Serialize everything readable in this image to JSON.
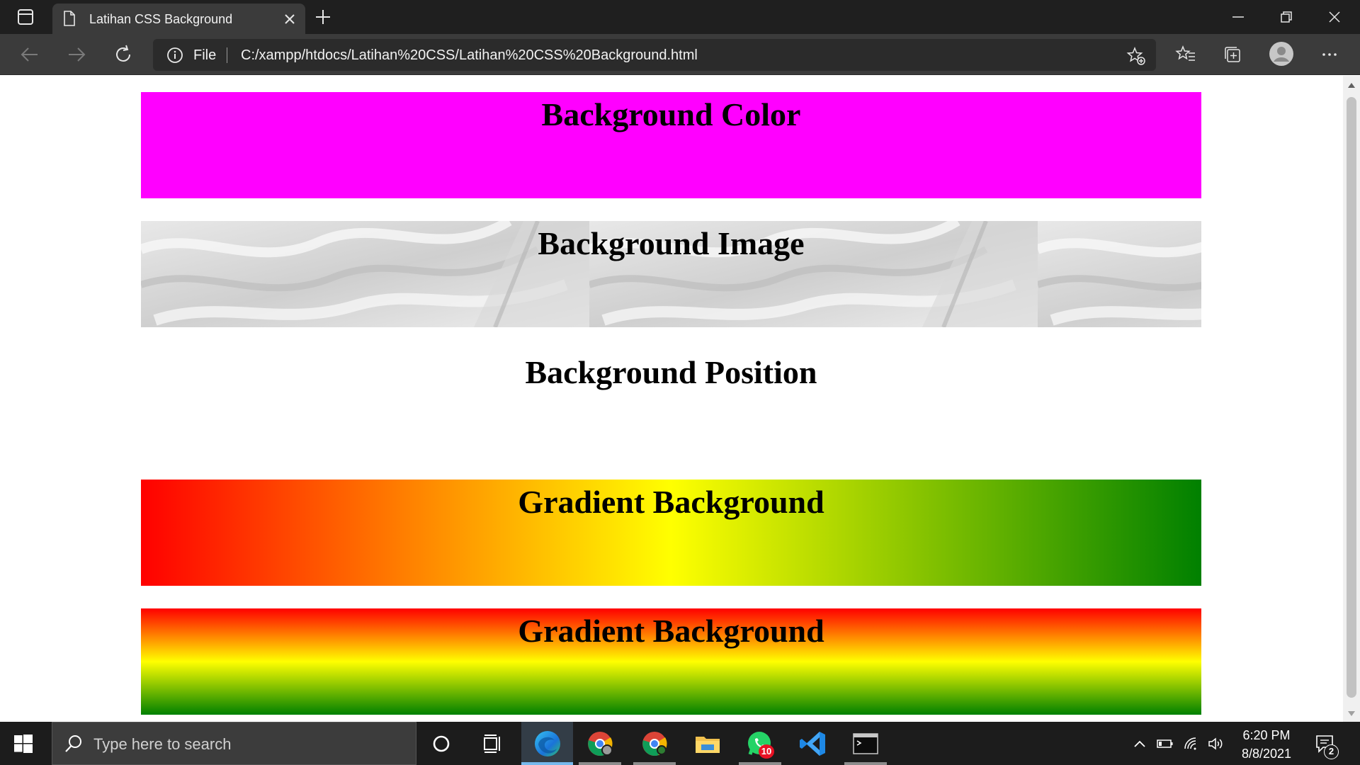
{
  "browser": {
    "tab_title": "Latihan CSS Background",
    "address_scheme": "File",
    "url": "C:/xampp/htdocs/Latihan%20CSS/Latihan%20CSS%20Background.html",
    "chrome_bg": "#1f1f1f",
    "toolbar_bg": "#3b3b3b"
  },
  "page": {
    "sections": [
      {
        "heading": "Background Color",
        "background": "#ff00ff"
      },
      {
        "heading": "Background Image",
        "background": "white silk texture (repeated)"
      },
      {
        "heading": "Background Position",
        "background": "#ffffff"
      },
      {
        "heading": "Gradient Background",
        "background": "linear-gradient to right: #ff0000, #ffff00, #008000"
      },
      {
        "heading": "Gradient Background",
        "background": "linear-gradient to bottom: #ff0000, #ffff00, #008000"
      }
    ]
  },
  "taskbar": {
    "search_placeholder": "Type here to search",
    "time": "6:20 PM",
    "date": "8/8/2021",
    "whatsapp_badge": "10",
    "notification_count": "2",
    "apps": [
      "cortana-icon",
      "task-view-icon",
      "edge-icon",
      "chrome-profile-icon",
      "chrome-icon",
      "file-explorer-icon",
      "whatsapp-icon",
      "vscode-icon",
      "terminal-icon"
    ]
  }
}
